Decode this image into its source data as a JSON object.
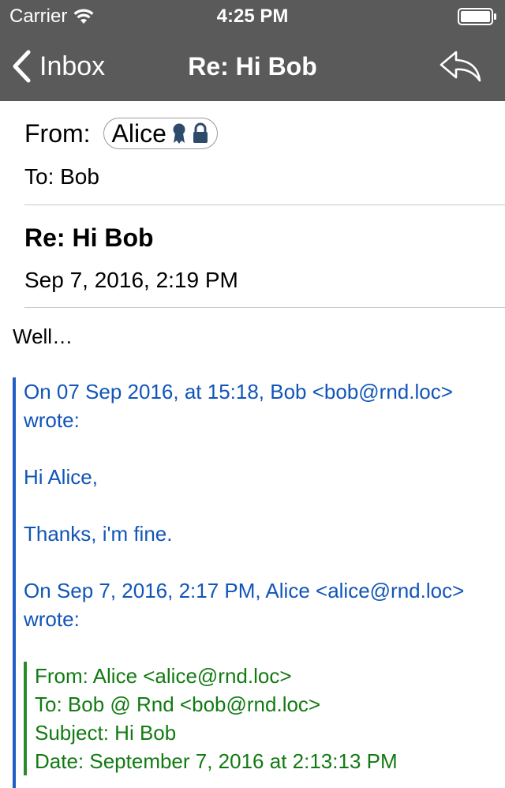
{
  "status_bar": {
    "carrier": "Carrier",
    "time": "4:25 PM",
    "icons": [
      "wifi-icon",
      "battery-icon"
    ]
  },
  "nav": {
    "back_label": "Inbox",
    "title": "Re: Hi Bob",
    "back_icon": "chevron-left-icon",
    "reply_icon": "reply-icon"
  },
  "header": {
    "from_label": "From:",
    "sender": "Alice",
    "sender_icons": [
      "verified-badge-icon",
      "lock-icon"
    ],
    "to": "To: Bob",
    "subject": "Re: Hi Bob",
    "date": "Sep 7, 2016, 2:19 PM"
  },
  "body": {
    "intro": "Well…",
    "quote_level1": {
      "attribution": "On 07 Sep 2016, at 15:18, Bob <bob@rnd.loc> wrote:",
      "greeting": "Hi Alice,",
      "message": "Thanks, i'm fine.",
      "attribution2": "On Sep 7, 2016, 2:17 PM, Alice <alice@rnd.loc> wrote:"
    },
    "quote_level2": {
      "from": "From: Alice <alice@rnd.loc>",
      "to": "To: Bob @ Rnd <bob@rnd.loc>",
      "subject": "Subject: Hi Bob",
      "date": "Date: September 7, 2016 at 2:13:13 PM"
    }
  },
  "colors": {
    "topbar": "#5a5a5a",
    "quote1": "#1155b8",
    "quote2": "#127a12"
  }
}
